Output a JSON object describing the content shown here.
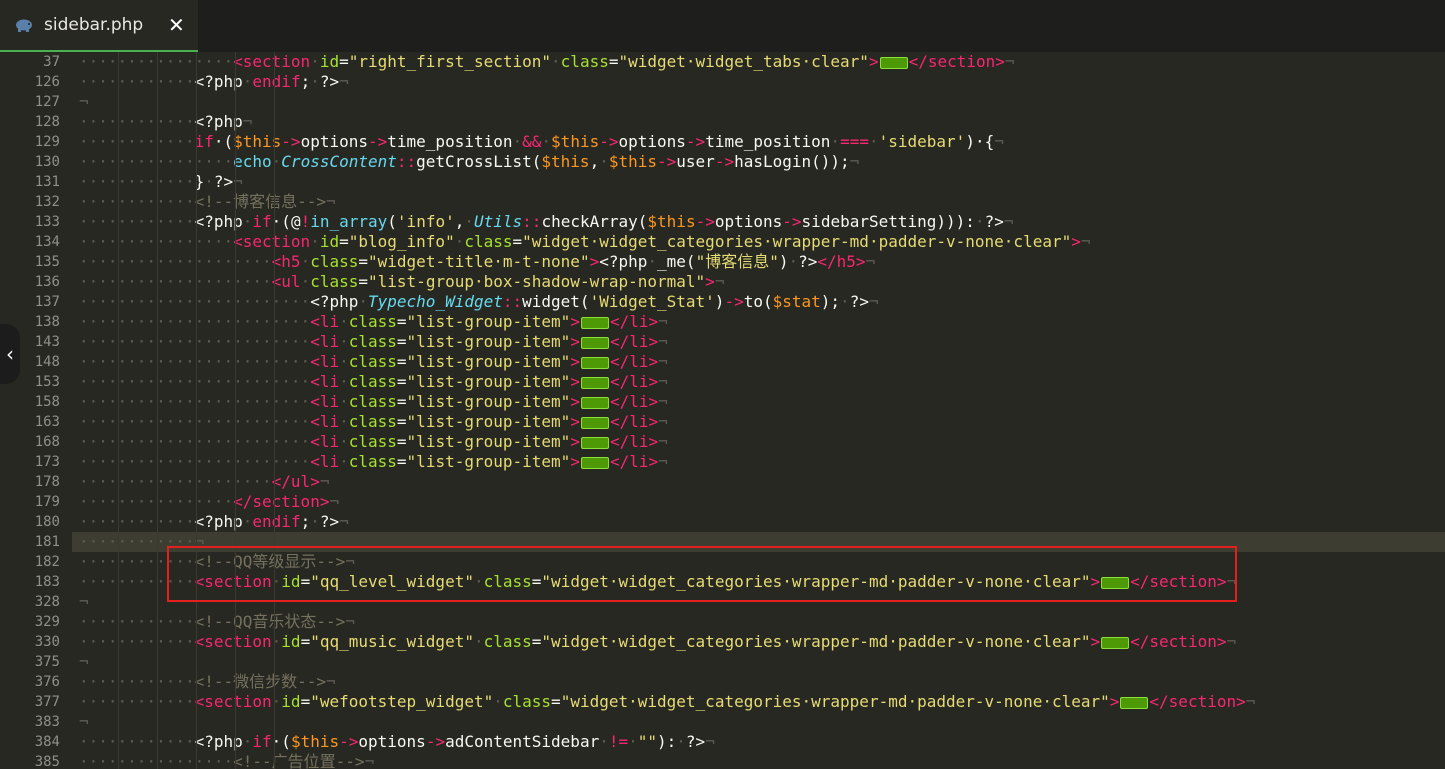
{
  "tab": {
    "title": "sidebar.php",
    "close": "✕",
    "icon": "php-elephant-icon"
  },
  "side_toggle": {
    "glyph": "‹"
  },
  "lines": [
    {
      "n": "37",
      "indent": 2,
      "tokens": [
        [
          "tg",
          "<section"
        ],
        [
          "",
          "·"
        ],
        [
          "at",
          "id"
        ],
        [
          "",
          "="
        ],
        [
          "st",
          "\"right_first_section\""
        ],
        [
          "",
          "·"
        ],
        [
          "at",
          "class"
        ],
        [
          "",
          "="
        ],
        [
          "st",
          "\"widget·widget_tabs·clear\""
        ],
        [
          "tg",
          ">"
        ],
        [
          "fold",
          ""
        ],
        [
          "tg",
          "</section>"
        ]
      ]
    },
    {
      "n": "126",
      "indent": 1,
      "tokens": [
        [
          "",
          "<?php"
        ],
        [
          "",
          "·"
        ],
        [
          "kw",
          "endif"
        ],
        [
          "",
          ";"
        ],
        [
          "",
          "·"
        ],
        [
          "",
          "?>"
        ]
      ]
    },
    {
      "n": "127",
      "indent": 0,
      "tokens": []
    },
    {
      "n": "128",
      "indent": 1,
      "tokens": [
        [
          "",
          "<?php"
        ]
      ]
    },
    {
      "n": "129",
      "indent": 1,
      "tokens": [
        [
          "kw",
          "if"
        ],
        [
          "",
          "·("
        ],
        [
          "vr",
          "$this"
        ],
        [
          "op",
          "->"
        ],
        [
          "",
          "options"
        ],
        [
          "op",
          "->"
        ],
        [
          "",
          "time_position"
        ],
        [
          "",
          "·"
        ],
        [
          "op",
          "&&"
        ],
        [
          "",
          "·"
        ],
        [
          "vr",
          "$this"
        ],
        [
          "op",
          "->"
        ],
        [
          "",
          "options"
        ],
        [
          "op",
          "->"
        ],
        [
          "",
          "time_position"
        ],
        [
          "",
          "·"
        ],
        [
          "op",
          "==="
        ],
        [
          "",
          "·"
        ],
        [
          "st",
          "'sidebar'"
        ],
        [
          "",
          ")"
        ],
        [
          "",
          "·{"
        ]
      ]
    },
    {
      "n": "130",
      "indent": 2,
      "tokens": [
        [
          "df",
          "echo"
        ],
        [
          "",
          "·"
        ],
        [
          "ty",
          "CrossContent"
        ],
        [
          "op",
          "::"
        ],
        [
          "",
          "getCrossList("
        ],
        [
          "vr",
          "$this"
        ],
        [
          "",
          ","
        ],
        [
          "",
          "·"
        ],
        [
          "vr",
          "$this"
        ],
        [
          "op",
          "->"
        ],
        [
          "",
          "user"
        ],
        [
          "op",
          "->"
        ],
        [
          "",
          "hasLogin());"
        ]
      ]
    },
    {
      "n": "131",
      "indent": 1,
      "tokens": [
        [
          "",
          "}"
        ],
        [
          "",
          "·"
        ],
        [
          "",
          "?>"
        ]
      ]
    },
    {
      "n": "132",
      "indent": 1,
      "tokens": [
        [
          "cm",
          "<!--博客信息-->"
        ]
      ]
    },
    {
      "n": "133",
      "indent": 1,
      "tokens": [
        [
          "",
          "<?php"
        ],
        [
          "",
          "·"
        ],
        [
          "kw",
          "if"
        ],
        [
          "",
          "·(@"
        ],
        [
          "op",
          "!"
        ],
        [
          "df",
          "in_array"
        ],
        [
          "",
          "("
        ],
        [
          "st",
          "'info'"
        ],
        [
          "",
          ","
        ],
        [
          "",
          "·"
        ],
        [
          "ty",
          "Utils"
        ],
        [
          "op",
          "::"
        ],
        [
          "",
          "checkArray("
        ],
        [
          "vr",
          "$this"
        ],
        [
          "op",
          "->"
        ],
        [
          "",
          "options"
        ],
        [
          "op",
          "->"
        ],
        [
          "",
          "sidebarSetting))):"
        ],
        [
          "",
          "·"
        ],
        [
          "",
          "?>"
        ]
      ]
    },
    {
      "n": "134",
      "indent": 2,
      "tokens": [
        [
          "tg",
          "<section"
        ],
        [
          "",
          "·"
        ],
        [
          "at",
          "id"
        ],
        [
          "",
          "="
        ],
        [
          "st",
          "\"blog_info\""
        ],
        [
          "",
          "·"
        ],
        [
          "at",
          "class"
        ],
        [
          "",
          "="
        ],
        [
          "st",
          "\"widget·widget_categories·wrapper-md·padder-v-none·clear\""
        ],
        [
          "tg",
          ">"
        ]
      ]
    },
    {
      "n": "135",
      "indent": 3,
      "tokens": [
        [
          "tg",
          "<h5"
        ],
        [
          "",
          "·"
        ],
        [
          "at",
          "class"
        ],
        [
          "",
          "="
        ],
        [
          "st",
          "\"widget-title·m-t-none\""
        ],
        [
          "tg",
          ">"
        ],
        [
          "",
          "<?php"
        ],
        [
          "",
          "·"
        ],
        [
          "",
          "_me("
        ],
        [
          "st",
          "\"博客信息\""
        ],
        [
          "",
          ")"
        ],
        [
          "",
          "·"
        ],
        [
          "",
          "?>"
        ],
        [
          "tg",
          "</h5>"
        ]
      ]
    },
    {
      "n": "136",
      "indent": 3,
      "tokens": [
        [
          "tg",
          "<ul"
        ],
        [
          "",
          "·"
        ],
        [
          "at",
          "class"
        ],
        [
          "",
          "="
        ],
        [
          "st",
          "\"list-group·box-shadow-wrap-normal\""
        ],
        [
          "tg",
          ">"
        ]
      ]
    },
    {
      "n": "137",
      "indent": 4,
      "tokens": [
        [
          "",
          "<?php"
        ],
        [
          "",
          "·"
        ],
        [
          "ty",
          "Typecho_Widget"
        ],
        [
          "op",
          "::"
        ],
        [
          "",
          "widget("
        ],
        [
          "st",
          "'Widget_Stat'"
        ],
        [
          "",
          ")"
        ],
        [
          "op",
          "->"
        ],
        [
          "",
          "to("
        ],
        [
          "vr",
          "$stat"
        ],
        [
          "",
          ");"
        ],
        [
          "",
          "·"
        ],
        [
          "",
          "?>"
        ]
      ]
    },
    {
      "n": "138",
      "indent": 4,
      "tokens": [
        [
          "tg",
          "<li"
        ],
        [
          "",
          "·"
        ],
        [
          "at",
          "class"
        ],
        [
          "",
          "="
        ],
        [
          "st",
          "\"list-group-item\""
        ],
        [
          "tg",
          ">"
        ],
        [
          "fold",
          ""
        ],
        [
          "tg",
          "</li>"
        ]
      ]
    },
    {
      "n": "143",
      "indent": 4,
      "tokens": [
        [
          "tg",
          "<li"
        ],
        [
          "",
          "·"
        ],
        [
          "at",
          "class"
        ],
        [
          "",
          "="
        ],
        [
          "st",
          "\"list-group-item\""
        ],
        [
          "tg",
          ">"
        ],
        [
          "fold",
          ""
        ],
        [
          "tg",
          "</li>"
        ]
      ]
    },
    {
      "n": "148",
      "indent": 4,
      "tokens": [
        [
          "tg",
          "<li"
        ],
        [
          "",
          "·"
        ],
        [
          "at",
          "class"
        ],
        [
          "",
          "="
        ],
        [
          "st",
          "\"list-group-item\""
        ],
        [
          "tg",
          ">"
        ],
        [
          "fold",
          ""
        ],
        [
          "tg",
          "</li>"
        ]
      ]
    },
    {
      "n": "153",
      "indent": 4,
      "tokens": [
        [
          "tg",
          "<li"
        ],
        [
          "",
          "·"
        ],
        [
          "at",
          "class"
        ],
        [
          "",
          "="
        ],
        [
          "st",
          "\"list-group-item\""
        ],
        [
          "tg",
          ">"
        ],
        [
          "fold",
          ""
        ],
        [
          "tg",
          "</li>"
        ]
      ]
    },
    {
      "n": "158",
      "indent": 4,
      "tokens": [
        [
          "tg",
          "<li"
        ],
        [
          "",
          "·"
        ],
        [
          "at",
          "class"
        ],
        [
          "",
          "="
        ],
        [
          "st",
          "\"list-group-item\""
        ],
        [
          "tg",
          ">"
        ],
        [
          "fold",
          ""
        ],
        [
          "tg",
          "</li>"
        ]
      ]
    },
    {
      "n": "163",
      "indent": 4,
      "tokens": [
        [
          "tg",
          "<li"
        ],
        [
          "",
          "·"
        ],
        [
          "at",
          "class"
        ],
        [
          "",
          "="
        ],
        [
          "st",
          "\"list-group-item\""
        ],
        [
          "tg",
          ">"
        ],
        [
          "fold",
          ""
        ],
        [
          "tg",
          "</li>"
        ]
      ]
    },
    {
      "n": "168",
      "indent": 4,
      "tokens": [
        [
          "tg",
          "<li"
        ],
        [
          "",
          "·"
        ],
        [
          "at",
          "class"
        ],
        [
          "",
          "="
        ],
        [
          "st",
          "\"list-group-item\""
        ],
        [
          "tg",
          ">"
        ],
        [
          "fold",
          ""
        ],
        [
          "tg",
          "</li>"
        ]
      ]
    },
    {
      "n": "173",
      "indent": 4,
      "tokens": [
        [
          "tg",
          "<li"
        ],
        [
          "",
          "·"
        ],
        [
          "at",
          "class"
        ],
        [
          "",
          "="
        ],
        [
          "st",
          "\"list-group-item\""
        ],
        [
          "tg",
          ">"
        ],
        [
          "fold",
          ""
        ],
        [
          "tg",
          "</li>"
        ]
      ]
    },
    {
      "n": "178",
      "indent": 3,
      "tokens": [
        [
          "tg",
          "</ul>"
        ]
      ]
    },
    {
      "n": "179",
      "indent": 2,
      "tokens": [
        [
          "tg",
          "</section>"
        ]
      ]
    },
    {
      "n": "180",
      "indent": 1,
      "tokens": [
        [
          "",
          "<?php"
        ],
        [
          "",
          "·"
        ],
        [
          "kw",
          "endif"
        ],
        [
          "",
          ";"
        ],
        [
          "",
          "·"
        ],
        [
          "",
          "?>"
        ]
      ]
    },
    {
      "n": "181",
      "indent": 1,
      "active": true,
      "tokens": []
    },
    {
      "n": "182",
      "indent": 1,
      "tokens": [
        [
          "cm",
          "<!--QQ等级显示-->"
        ]
      ]
    },
    {
      "n": "183",
      "indent": 1,
      "tokens": [
        [
          "tg",
          "<section"
        ],
        [
          "",
          "·"
        ],
        [
          "at",
          "id"
        ],
        [
          "",
          "="
        ],
        [
          "st",
          "\"qq_level_widget\""
        ],
        [
          "",
          "·"
        ],
        [
          "at",
          "class"
        ],
        [
          "",
          "="
        ],
        [
          "st",
          "\"widget·widget_categories·wrapper-md·padder-v-none·clear\""
        ],
        [
          "tg",
          ">"
        ],
        [
          "fold",
          ""
        ],
        [
          "tg",
          "</section>"
        ]
      ]
    },
    {
      "n": "328",
      "indent": 0,
      "tokens": []
    },
    {
      "n": "329",
      "indent": 1,
      "tokens": [
        [
          "cm",
          "<!--QQ音乐状态-->"
        ]
      ]
    },
    {
      "n": "330",
      "indent": 1,
      "tokens": [
        [
          "tg",
          "<section"
        ],
        [
          "",
          "·"
        ],
        [
          "at",
          "id"
        ],
        [
          "",
          "="
        ],
        [
          "st",
          "\"qq_music_widget\""
        ],
        [
          "",
          "·"
        ],
        [
          "at",
          "class"
        ],
        [
          "",
          "="
        ],
        [
          "st",
          "\"widget·widget_categories·wrapper-md·padder-v-none·clear\""
        ],
        [
          "tg",
          ">"
        ],
        [
          "fold",
          ""
        ],
        [
          "tg",
          "</section>"
        ]
      ]
    },
    {
      "n": "375",
      "indent": 0,
      "tokens": []
    },
    {
      "n": "376",
      "indent": 1,
      "tokens": [
        [
          "cm",
          "<!--微信步数-->"
        ]
      ]
    },
    {
      "n": "377",
      "indent": 1,
      "tokens": [
        [
          "tg",
          "<section"
        ],
        [
          "",
          "·"
        ],
        [
          "at",
          "id"
        ],
        [
          "",
          "="
        ],
        [
          "st",
          "\"wefootstep_widget\""
        ],
        [
          "",
          "·"
        ],
        [
          "at",
          "class"
        ],
        [
          "",
          "="
        ],
        [
          "st",
          "\"widget·widget_categories·wrapper-md·padder-v-none·clear\""
        ],
        [
          "tg",
          ">"
        ],
        [
          "fold",
          ""
        ],
        [
          "tg",
          "</section>"
        ]
      ]
    },
    {
      "n": "383",
      "indent": 0,
      "tokens": []
    },
    {
      "n": "384",
      "indent": 1,
      "tokens": [
        [
          "",
          "<?php"
        ],
        [
          "",
          "·"
        ],
        [
          "kw",
          "if"
        ],
        [
          "",
          "·("
        ],
        [
          "vr",
          "$this"
        ],
        [
          "op",
          "->"
        ],
        [
          "",
          "options"
        ],
        [
          "op",
          "->"
        ],
        [
          "",
          "adContentSidebar"
        ],
        [
          "",
          "·"
        ],
        [
          "op",
          "!="
        ],
        [
          "",
          "·"
        ],
        [
          "st",
          "\"\""
        ],
        [
          "",
          "):"
        ],
        [
          "",
          "·"
        ],
        [
          "",
          "?>"
        ]
      ]
    },
    {
      "n": "385",
      "indent": 2,
      "tokens": [
        [
          "cm",
          "<!--广告位置-->"
        ]
      ]
    }
  ]
}
